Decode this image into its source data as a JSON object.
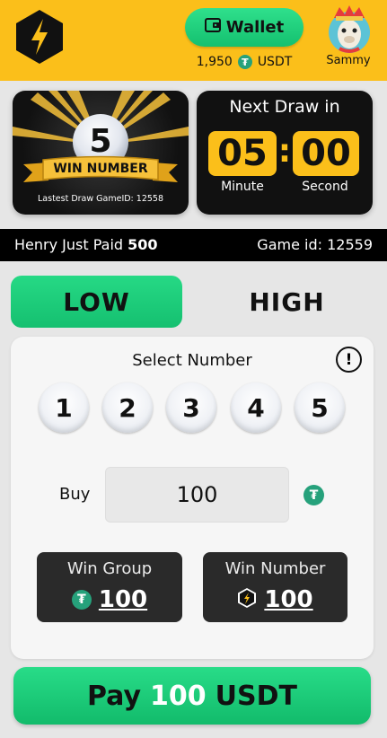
{
  "header": {
    "wallet_label": "Wallet",
    "balance": "1,950",
    "currency": "USDT",
    "username": "Sammy"
  },
  "last_draw": {
    "number": "5",
    "banner": "WIN NUMBER",
    "caption": "Lastest Draw GameID: 12558"
  },
  "next_draw": {
    "title": "Next Draw in",
    "minutes": "05",
    "seconds": "00",
    "minute_label": "Minute",
    "second_label": "Second"
  },
  "ticker": {
    "message": "Henry Just Paid",
    "amount": "500",
    "game": "Game id: 12559"
  },
  "mode": {
    "low_label": "LOW",
    "high_label": "HIGH",
    "selected": "LOW"
  },
  "select": {
    "title": "Select Number",
    "numbers": [
      "1",
      "2",
      "3",
      "4",
      "5"
    ]
  },
  "buy": {
    "label": "Buy",
    "value": "100"
  },
  "win_group": {
    "title": "Win Group",
    "amount": "100"
  },
  "win_number": {
    "title": "Win Number",
    "amount": "100"
  },
  "pay": {
    "prefix": "Pay",
    "amount": "100",
    "currency": "USDT"
  },
  "colors": {
    "accent_yellow": "#fbbf1a",
    "accent_green": "#1fcf7c",
    "tether_green": "#26a17b",
    "dark": "#111111"
  },
  "icons": [
    "lightning-logo-icon",
    "wallet-icon",
    "tether-icon",
    "llama-avatar",
    "info-icon"
  ]
}
